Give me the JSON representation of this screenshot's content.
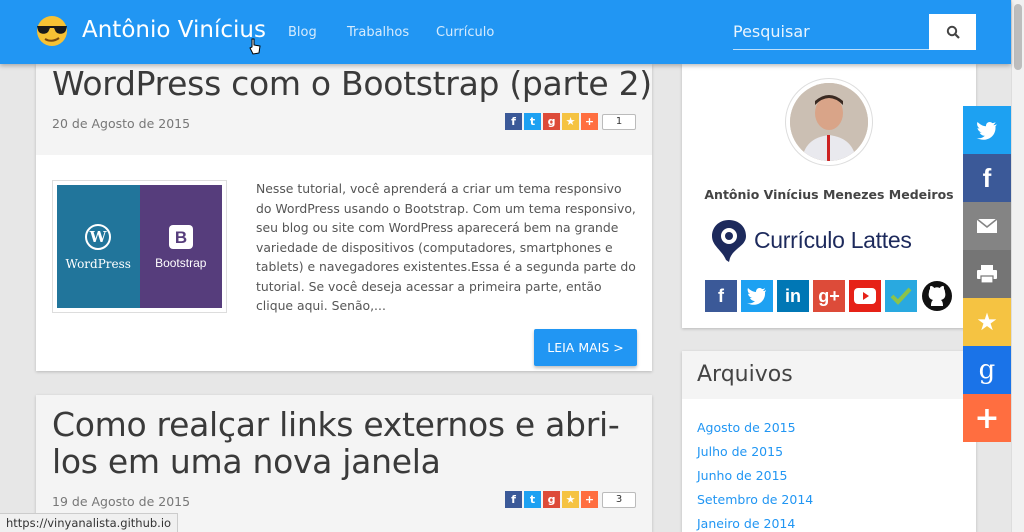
{
  "header": {
    "site_name": "Antônio Vinícius",
    "nav": [
      "Blog",
      "Trabalhos",
      "Currículo"
    ],
    "search_placeholder": "Pesquisar"
  },
  "posts": [
    {
      "title": "WordPress com o Bootstrap (parte 2)",
      "date": "20 de Agosto de 2015",
      "share_count": "1",
      "thumbnail": {
        "left_label": "WordPress",
        "right_label": "Bootstrap"
      },
      "excerpt": "Nesse tutorial, você aprenderá a criar um tema responsivo do WordPress usando o Bootstrap. Com um tema responsivo, seu blog ou site com WordPress aparecerá bem na grande variedade de dispositivos (computadores, smartphones e tablets) e navegadores existentes.Essa é a segunda parte do tutorial. Se você deseja acessar a primeira parte, então clique aqui. Senão,...",
      "read_more": "LEIA MAIS >"
    },
    {
      "title": "Como realçar links externos e abri-los em uma nova janela",
      "date": "19 de Agosto de 2015",
      "share_count": "3"
    }
  ],
  "sidebar": {
    "profile_name": "Antônio Vinícius Menezes Medeiros",
    "lattes_label": "Currículo Lattes",
    "social_icons": [
      "facebook-icon",
      "twitter-icon",
      "linkedin-icon",
      "google-plus-icon",
      "youtube-icon",
      "foursquare-icon",
      "github-icon"
    ],
    "archives_title": "Arquivos",
    "archives": [
      "Agosto de 2015",
      "Julho de 2015",
      "Junho de 2015",
      "Setembro de 2014",
      "Janeiro de 2014"
    ]
  },
  "floating_share": [
    "twitter-icon",
    "facebook-icon",
    "email-icon",
    "print-icon",
    "favorite-icon",
    "google-icon",
    "more-icon"
  ],
  "status_bar": "https://vinyanalista.github.io",
  "colors": {
    "primary": "#2196f3",
    "twitter": "#1da1f2",
    "facebook": "#3b5998",
    "email": "#848484",
    "print": "#757575",
    "favorite": "#f5c342",
    "google": "#1a73e8",
    "more": "#ff6e40"
  }
}
